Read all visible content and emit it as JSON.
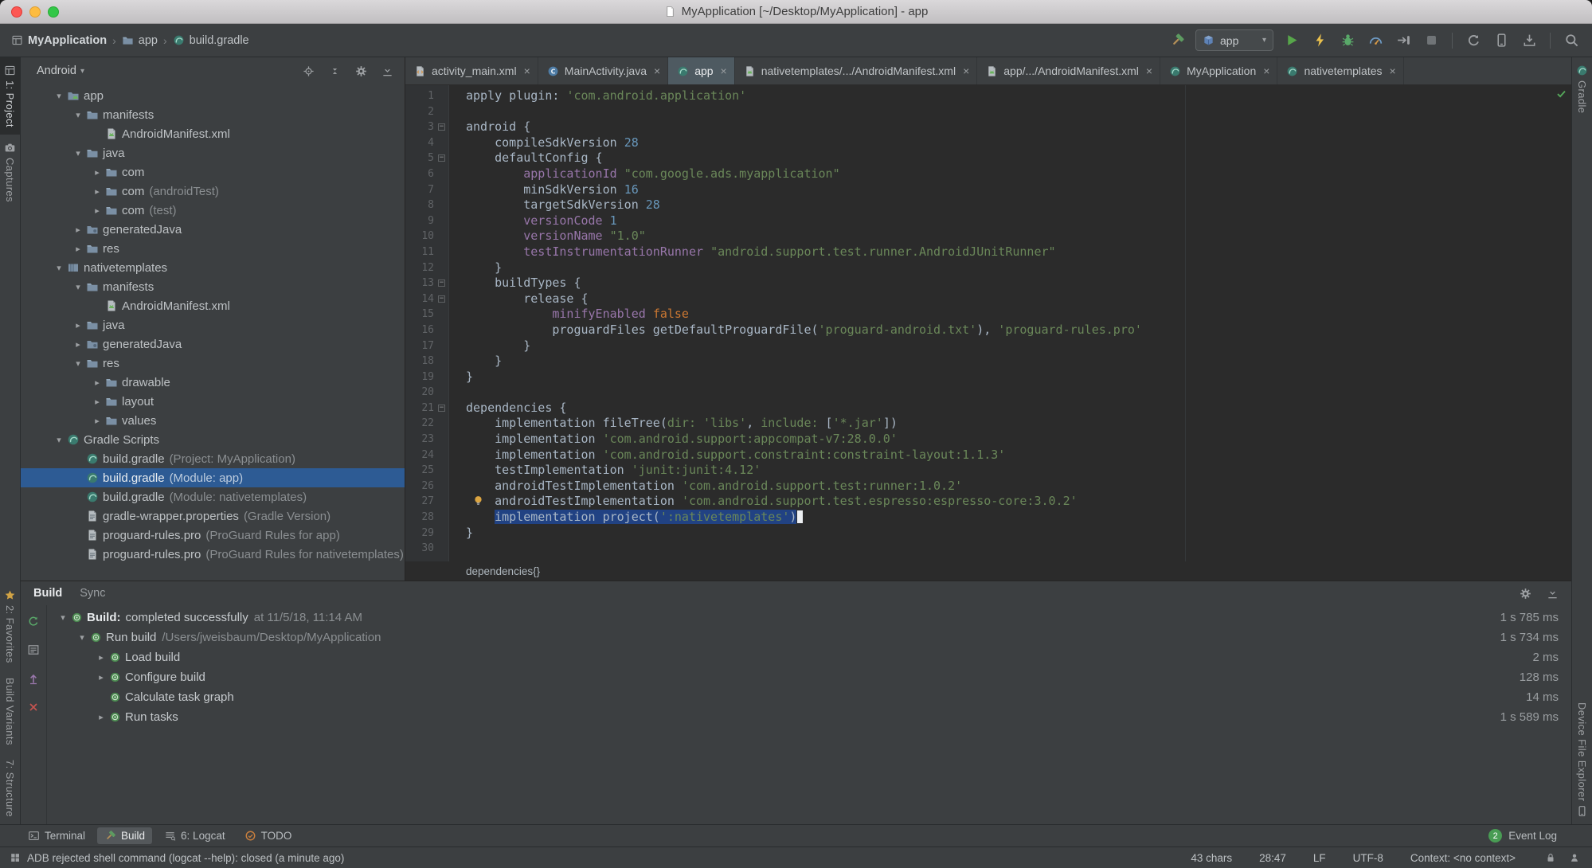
{
  "colors": {
    "panel_bg": "#3c3f41",
    "editor_bg": "#2b2b2b",
    "tree_selection": "#2d5b94",
    "code_selection": "#214283",
    "keyword": "#cc7832",
    "string": "#6a8759",
    "number": "#6897bb",
    "property": "#9876aa",
    "run_green": "#59a869",
    "error_red": "#c75450"
  },
  "titlebar": {
    "title": "MyApplication [~/Desktop/MyApplication] - app"
  },
  "toolbar": {
    "breadcrumbs": [
      {
        "label": "MyApplication",
        "icon": "project-icon"
      },
      {
        "label": "app",
        "icon": "folder-icon"
      },
      {
        "label": "build.gradle",
        "icon": "gradle-icon"
      }
    ],
    "make_button": {
      "name": "make-project-button",
      "icon": "hammer-icon"
    },
    "run_config": {
      "label": "app",
      "icon": "module-box-icon"
    },
    "actions": [
      {
        "name": "run-button",
        "icon": "play-icon"
      },
      {
        "name": "apply-changes-button",
        "icon": "lightning-icon"
      },
      {
        "name": "debug-button",
        "icon": "bug-icon"
      },
      {
        "name": "profile-button",
        "icon": "gauge-icon"
      },
      {
        "name": "attach-debugger-button",
        "icon": "attach-icon"
      },
      {
        "name": "stop-button",
        "icon": "stop-icon"
      },
      {
        "name": "toolbar-separator"
      },
      {
        "name": "sync-gradle-button",
        "icon": "sync-icon"
      },
      {
        "name": "avd-manager-button",
        "icon": "phone-icon"
      },
      {
        "name": "sdk-manager-button",
        "icon": "download-icon"
      },
      {
        "name": "toolbar-separator"
      },
      {
        "name": "search-everywhere-button",
        "icon": "search-icon"
      }
    ]
  },
  "left_stripe": {
    "top": [
      {
        "name": "tool-button-project",
        "label": "1: Project",
        "icon": "project-icon",
        "active": true
      },
      {
        "name": "tool-button-captures",
        "label": "Captures",
        "icon": "camera-icon"
      }
    ],
    "bottom": [
      {
        "name": "tool-button-favorites",
        "label": "2: Favorites",
        "icon": "star-icon"
      },
      {
        "name": "tool-button-build-variants",
        "label": "Build Variants"
      },
      {
        "name": "tool-button-structure",
        "label": "7: Structure"
      }
    ]
  },
  "right_stripe": {
    "top": [
      {
        "name": "tool-button-gradle",
        "label": "Gradle",
        "icon": "gradle-icon"
      }
    ],
    "bottom": [
      {
        "name": "tool-button-device-file-explorer",
        "label": "Device File Explorer",
        "icon": "phone-icon",
        "icon_after": true
      }
    ]
  },
  "project_panel": {
    "view_label": "Android",
    "header_icons": [
      "locate-icon",
      "collapse-all-icon",
      "gear-icon",
      "hide-icon"
    ],
    "tree": [
      {
        "label": "app",
        "icon": "module-android-icon",
        "depth": 0,
        "arrow": "expanded"
      },
      {
        "label": "manifests",
        "icon": "folder-icon",
        "depth": 1,
        "arrow": "expanded"
      },
      {
        "label": "AndroidManifest.xml",
        "icon": "manifest-icon",
        "depth": 2,
        "arrow": "none"
      },
      {
        "label": "java",
        "icon": "folder-icon",
        "depth": 1,
        "arrow": "expanded"
      },
      {
        "label": "com",
        "icon": "package-icon",
        "depth": 2,
        "arrow": "collapsed"
      },
      {
        "label": "com",
        "suffix": "(androidTest)",
        "icon": "package-icon",
        "depth": 2,
        "arrow": "collapsed"
      },
      {
        "label": "com",
        "suffix": "(test)",
        "icon": "package-icon",
        "depth": 2,
        "arrow": "collapsed"
      },
      {
        "label": "generatedJava",
        "icon": "generated-folder-icon",
        "depth": 1,
        "arrow": "collapsed"
      },
      {
        "label": "res",
        "icon": "res-folder-icon",
        "depth": 1,
        "arrow": "collapsed"
      },
      {
        "label": "nativetemplates",
        "icon": "module-library-icon",
        "depth": 0,
        "arrow": "expanded"
      },
      {
        "label": "manifests",
        "icon": "folder-icon",
        "depth": 1,
        "arrow": "expanded"
      },
      {
        "label": "AndroidManifest.xml",
        "icon": "manifest-icon",
        "depth": 2,
        "arrow": "none"
      },
      {
        "label": "java",
        "icon": "folder-icon",
        "depth": 1,
        "arrow": "collapsed"
      },
      {
        "label": "generatedJava",
        "icon": "generated-folder-icon",
        "depth": 1,
        "arrow": "collapsed"
      },
      {
        "label": "res",
        "icon": "res-folder-icon",
        "depth": 1,
        "arrow": "expanded"
      },
      {
        "label": "drawable",
        "icon": "folder-icon",
        "depth": 2,
        "arrow": "collapsed"
      },
      {
        "label": "layout",
        "icon": "folder-icon",
        "depth": 2,
        "arrow": "collapsed"
      },
      {
        "label": "values",
        "icon": "folder-icon",
        "depth": 2,
        "arrow": "collapsed"
      },
      {
        "label": "Gradle Scripts",
        "icon": "gradle-icon",
        "depth": 0,
        "arrow": "expanded"
      },
      {
        "label": "build.gradle",
        "suffix": "(Project: MyApplication)",
        "icon": "gradle-icon",
        "depth": 1,
        "arrow": "none"
      },
      {
        "label": "build.gradle",
        "suffix": "(Module: app)",
        "icon": "gradle-icon",
        "depth": 1,
        "arrow": "none",
        "selected": true
      },
      {
        "label": "build.gradle",
        "suffix": "(Module: nativetemplates)",
        "icon": "gradle-icon",
        "depth": 1,
        "arrow": "none"
      },
      {
        "label": "gradle-wrapper.properties",
        "suffix": "(Gradle Version)",
        "icon": "properties-icon",
        "depth": 1,
        "arrow": "none"
      },
      {
        "label": "proguard-rules.pro",
        "suffix": "(ProGuard Rules for app)",
        "icon": "text-file-icon",
        "depth": 1,
        "arrow": "none"
      },
      {
        "label": "proguard-rules.pro",
        "suffix": "(ProGuard Rules for nativetemplates)",
        "icon": "text-file-icon",
        "depth": 1,
        "arrow": "none"
      }
    ]
  },
  "editor_tabs": [
    {
      "label": "activity_main.xml",
      "icon": "layout-file-icon"
    },
    {
      "label": "MainActivity.java",
      "icon": "class-icon"
    },
    {
      "label": "app",
      "icon": "gradle-icon",
      "selected": true
    },
    {
      "label": "nativetemplates/.../AndroidManifest.xml",
      "icon": "manifest-icon"
    },
    {
      "label": "app/.../AndroidManifest.xml",
      "icon": "manifest-icon"
    },
    {
      "label": "MyApplication",
      "icon": "gradle-icon"
    },
    {
      "label": "nativetemplates",
      "icon": "gradle-icon"
    }
  ],
  "editor": {
    "breadcrumb": "dependencies{}",
    "caret_line": 28,
    "bulb_line": 27,
    "inspection_ok": true,
    "lines": [
      {
        "tokens": [
          [
            "p",
            "apply plugin: "
          ],
          [
            "s",
            "'com.android.application'"
          ]
        ]
      },
      {
        "tokens": []
      },
      {
        "tokens": [
          [
            "p",
            "android {"
          ]
        ],
        "fold": true
      },
      {
        "tokens": [
          [
            "p",
            "    compileSdkVersion "
          ],
          [
            "n",
            "28"
          ]
        ]
      },
      {
        "tokens": [
          [
            "p",
            "    defaultConfig {"
          ]
        ],
        "fold": true
      },
      {
        "tokens": [
          [
            "p",
            "        "
          ],
          [
            "pr",
            "applicationId"
          ],
          [
            "p",
            " "
          ],
          [
            "s",
            "\"com.google.ads.myapplication\""
          ]
        ]
      },
      {
        "tokens": [
          [
            "p",
            "        minSdkVersion "
          ],
          [
            "n",
            "16"
          ]
        ]
      },
      {
        "tokens": [
          [
            "p",
            "        targetSdkVersion "
          ],
          [
            "n",
            "28"
          ]
        ]
      },
      {
        "tokens": [
          [
            "p",
            "        "
          ],
          [
            "pr",
            "versionCode"
          ],
          [
            "p",
            " "
          ],
          [
            "n",
            "1"
          ]
        ]
      },
      {
        "tokens": [
          [
            "p",
            "        "
          ],
          [
            "pr",
            "versionName"
          ],
          [
            "p",
            " "
          ],
          [
            "s",
            "\"1.0\""
          ]
        ]
      },
      {
        "tokens": [
          [
            "p",
            "        "
          ],
          [
            "pr",
            "testInstrumentationRunner"
          ],
          [
            "p",
            " "
          ],
          [
            "s",
            "\"android.support.test.runner.AndroidJUnitRunner\""
          ]
        ]
      },
      {
        "tokens": [
          [
            "p",
            "    }"
          ]
        ]
      },
      {
        "tokens": [
          [
            "p",
            "    buildTypes {"
          ]
        ],
        "fold": true
      },
      {
        "tokens": [
          [
            "p",
            "        release {"
          ]
        ],
        "fold": true
      },
      {
        "tokens": [
          [
            "p",
            "            "
          ],
          [
            "pr",
            "minifyEnabled"
          ],
          [
            "p",
            " "
          ],
          [
            "k",
            "false"
          ]
        ]
      },
      {
        "tokens": [
          [
            "p",
            "            proguardFiles getDefaultProguardFile("
          ],
          [
            "s",
            "'proguard-android.txt'"
          ],
          [
            "p",
            "), "
          ],
          [
            "s",
            "'proguard-rules.pro'"
          ]
        ]
      },
      {
        "tokens": [
          [
            "p",
            "        }"
          ]
        ]
      },
      {
        "tokens": [
          [
            "p",
            "    }"
          ]
        ]
      },
      {
        "tokens": [
          [
            "p",
            "}"
          ]
        ]
      },
      {
        "tokens": []
      },
      {
        "tokens": [
          [
            "p",
            "dependencies {"
          ]
        ],
        "fold": true
      },
      {
        "tokens": [
          [
            "p",
            "    implementation fileTree("
          ],
          [
            "na",
            "dir:"
          ],
          [
            "p",
            " "
          ],
          [
            "s",
            "'libs'"
          ],
          [
            "p",
            ", "
          ],
          [
            "na",
            "include:"
          ],
          [
            "p",
            " ["
          ],
          [
            "s",
            "'*.jar'"
          ],
          [
            "p",
            "])"
          ]
        ]
      },
      {
        "tokens": [
          [
            "p",
            "    implementation "
          ],
          [
            "s",
            "'com.android.support:appcompat-v7:28.0.0'"
          ]
        ]
      },
      {
        "tokens": [
          [
            "p",
            "    implementation "
          ],
          [
            "s",
            "'com.android.support.constraint:constraint-layout:1.1.3'"
          ]
        ]
      },
      {
        "tokens": [
          [
            "p",
            "    testImplementation "
          ],
          [
            "s",
            "'junit:junit:4.12'"
          ]
        ]
      },
      {
        "tokens": [
          [
            "p",
            "    androidTestImplementation "
          ],
          [
            "s",
            "'com.android.support.test:runner:1.0.2'"
          ]
        ]
      },
      {
        "tokens": [
          [
            "p",
            "    androidTestImplementation "
          ],
          [
            "s",
            "'com.android.support.test.espresso:espresso-core:3.0.2'"
          ]
        ]
      },
      {
        "tokens": [
          [
            "p",
            "    "
          ],
          [
            "p",
            "implementation project(",
            1
          ],
          [
            "s",
            "':nativetemplates'",
            1
          ],
          [
            "p",
            ")",
            1
          ]
        ]
      },
      {
        "tokens": [
          [
            "p",
            "}"
          ]
        ]
      },
      {
        "tokens": []
      }
    ]
  },
  "build_panel": {
    "tabs": [
      {
        "label": "Build",
        "selected": true
      },
      {
        "label": "Sync"
      }
    ],
    "header_icons": [
      "gear-icon",
      "hide-icon"
    ],
    "left_toolbar": [
      "rerun-icon",
      "toggle-view-icon",
      "export-icon",
      "close-red-icon"
    ],
    "rows": [
      {
        "depth": 0,
        "arrow": "expanded",
        "icon": "gradle-task-icon",
        "bold": "Build:",
        "text": "completed successfully",
        "dim": "at 11/5/18, 11:14 AM",
        "time": "1 s 785 ms"
      },
      {
        "depth": 1,
        "arrow": "expanded",
        "icon": "gradle-task-icon",
        "text": "Run build",
        "dim": "/Users/jweisbaum/Desktop/MyApplication",
        "time": "1 s 734 ms"
      },
      {
        "depth": 2,
        "arrow": "collapsed",
        "icon": "gradle-task-icon",
        "text": "Load build",
        "time": "2 ms"
      },
      {
        "depth": 2,
        "arrow": "collapsed",
        "icon": "gradle-task-icon",
        "text": "Configure build",
        "time": "128 ms"
      },
      {
        "depth": 2,
        "arrow": "none",
        "icon": "gradle-task-icon",
        "text": "Calculate task graph",
        "time": "14 ms"
      },
      {
        "depth": 2,
        "arrow": "collapsed",
        "icon": "gradle-task-icon",
        "text": "Run tasks",
        "time": "1 s 589 ms"
      }
    ]
  },
  "bottom_bar": {
    "left": [
      {
        "name": "terminal-button",
        "icon": "terminal-icon",
        "label": "Terminal"
      },
      {
        "name": "build-button",
        "icon": "hammer-icon",
        "label": "Build",
        "active": true
      },
      {
        "name": "logcat-button",
        "icon": "logcat-icon",
        "label": "6: Logcat"
      },
      {
        "name": "todo-button",
        "icon": "todo-icon",
        "label": "TODO"
      }
    ],
    "right": {
      "badge": "2",
      "label": "Event Log"
    }
  },
  "status_bar": {
    "message": "ADB rejected shell command (logcat --help): closed (a minute ago)",
    "right_items": [
      "43 chars",
      "28:47",
      "LF",
      "UTF-8",
      "Context: <no context>"
    ],
    "right_icons": [
      "lock-icon",
      "inspections-icon"
    ]
  }
}
